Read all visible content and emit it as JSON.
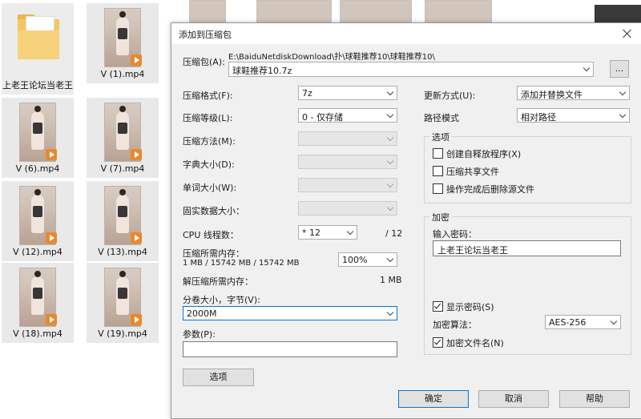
{
  "explorer": {
    "files": [
      {
        "name": "上老王论坛当老王",
        "type": "folder"
      },
      {
        "name": "V (1).mp4",
        "type": "video"
      },
      {
        "name": "V (6).mp4",
        "type": "video"
      },
      {
        "name": "V (7).mp4",
        "type": "video"
      },
      {
        "name": "V (12).mp4",
        "type": "video"
      },
      {
        "name": "V (13).mp4",
        "type": "video"
      },
      {
        "name": "V (18).mp4",
        "type": "video"
      },
      {
        "name": "V (19).mp4",
        "type": "video"
      }
    ]
  },
  "dialog": {
    "title": "添加到压缩包",
    "archive_label": "压缩包(A):",
    "archive_path": "E:\\BaiduNetdiskDownload\\扑\\球鞋推荐10\\球鞋推荐10\\",
    "archive_name": "球鞋推荐10.7z",
    "browse_label": "...",
    "format_label": "压缩格式(F):",
    "format_value": "7z",
    "level_label": "压缩等级(L):",
    "level_value": "0 - 仅存储",
    "method_label": "压缩方法(M):",
    "dict_label": "字典大小(D):",
    "word_label": "单词大小(W):",
    "solid_label": "固实数据大小：",
    "cpu_label": "CPU 线程数：",
    "cpu_value": "* 12",
    "cpu_total": "/ 12",
    "mem_label": "压缩所需内存：",
    "mem_detail": "1 MB / 15742 MB / 15742 MB",
    "mem_percent": "100%",
    "decomp_label": "解压缩所需内存：",
    "decomp_value": "1 MB",
    "split_label": "分卷大小，字节(V):",
    "split_value": "2000M",
    "params_label": "参数(P):",
    "params_value": "",
    "options_btn": "选项",
    "update_label": "更新方式(U):",
    "update_value": "添加并替换文件",
    "path_label": "路径模式",
    "path_value": "相对路径",
    "options_group": "选项",
    "opt_sfx": "创建自释放程序(X)",
    "opt_shared": "压缩共享文件",
    "opt_delete": "操作完成后删除源文件",
    "enc_group": "加密",
    "password_label": "输入密码：",
    "password_value": "上老王论坛当老王",
    "show_password": "显示密码(S)",
    "enc_method_label": "加密算法：",
    "enc_method_value": "AES-256",
    "enc_names": "加密文件名(N)",
    "ok_btn": "确定",
    "cancel_btn": "取消",
    "help_btn": "帮助"
  }
}
